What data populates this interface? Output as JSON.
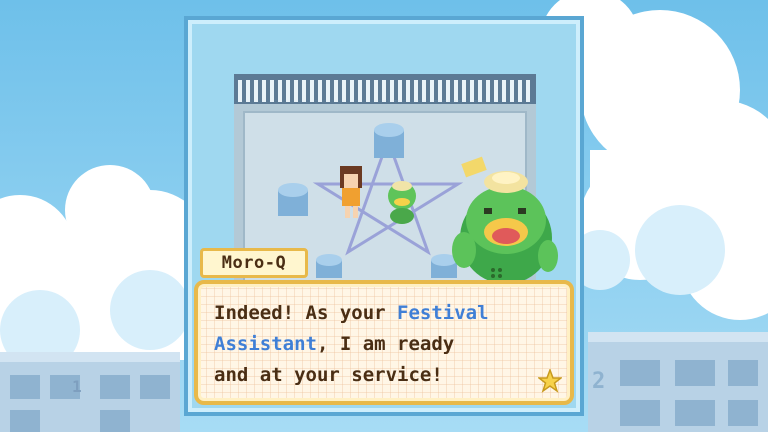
{
  "speaker": {
    "name": "Moro-Q"
  },
  "dialogue": {
    "line1_a": "Indeed! As your ",
    "line1_b": "Festival",
    "line2_a": "Assistant",
    "line2_b": ", I am ready",
    "line3": "and at your service!"
  },
  "background": {
    "building_left_number": "1",
    "building_right_number": "2"
  },
  "colors": {
    "sky": "#7ec8ec",
    "highlight": "#3f7fd6",
    "frame_border": "#e8b94a",
    "text": "#4a2e14"
  },
  "icons": {
    "advance": "star-icon"
  }
}
